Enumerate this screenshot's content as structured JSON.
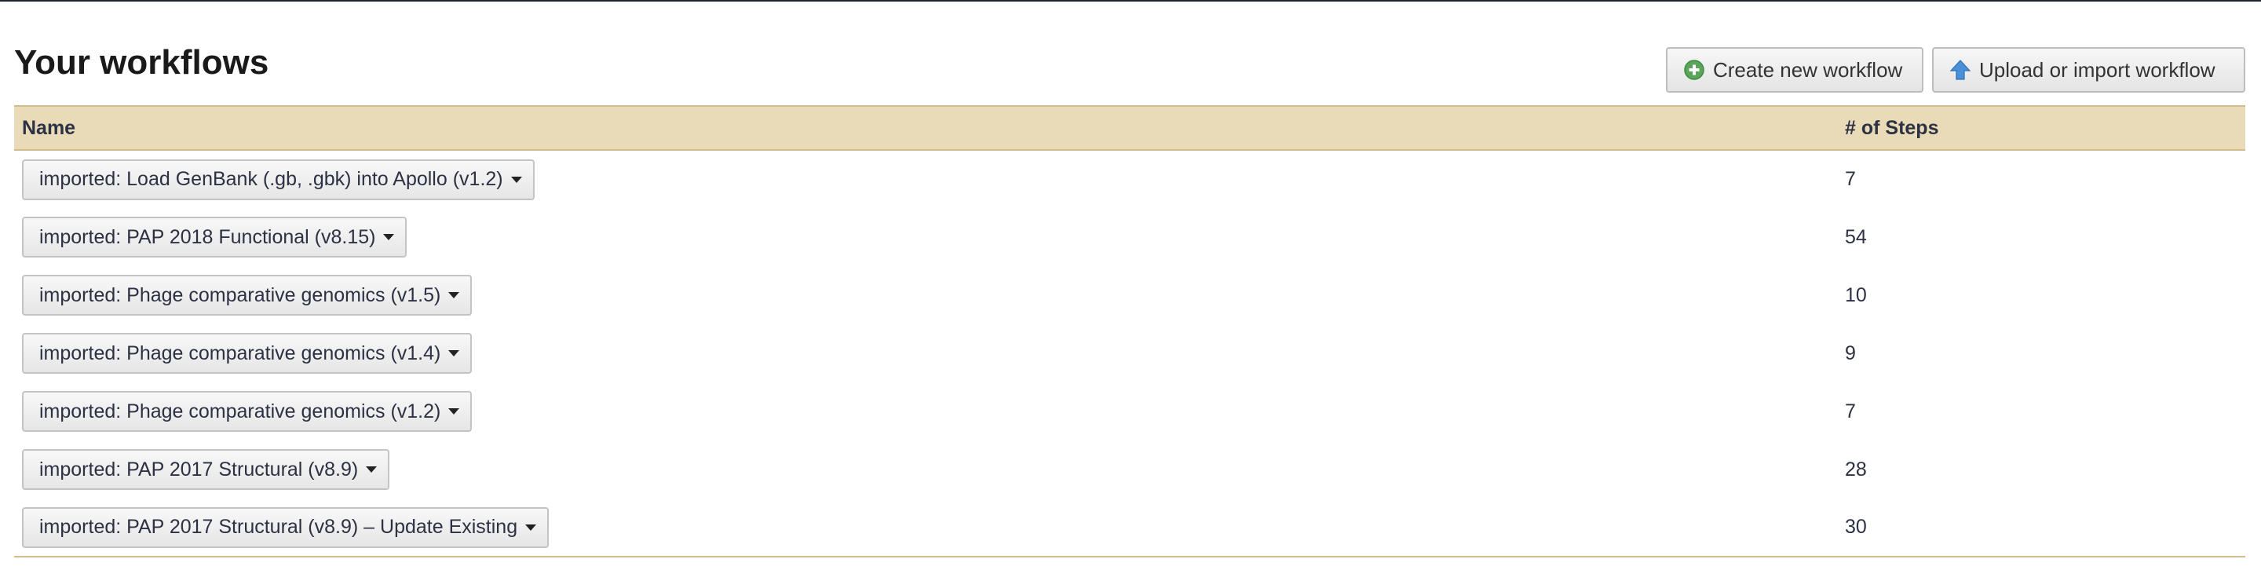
{
  "page_title": "Your workflows",
  "actions": {
    "create_label": "Create new workflow",
    "create_icon": "plus-circle-icon",
    "upload_label": "Upload or import workflow",
    "upload_icon": "upload-arrow-icon"
  },
  "table": {
    "columns": [
      "Name",
      "# of Steps"
    ],
    "rows": [
      {
        "name": "imported: Load GenBank (.gb, .gbk) into Apollo (v1.2)",
        "steps": "7"
      },
      {
        "name": "imported: PAP 2018 Functional (v8.15)",
        "steps": "54"
      },
      {
        "name": "imported: Phage comparative genomics (v1.5)",
        "steps": "10"
      },
      {
        "name": "imported: Phage comparative genomics (v1.4)",
        "steps": "9"
      },
      {
        "name": "imported: Phage comparative genomics (v1.2)",
        "steps": "7"
      },
      {
        "name": "imported: PAP 2017 Structural (v8.9)",
        "steps": "28"
      },
      {
        "name": "imported: PAP 2017 Structural (v8.9) – Update Existing",
        "steps": "30"
      }
    ]
  },
  "colors": {
    "header_bg": "#e9dbb7",
    "header_border": "#d2bd8a",
    "create_icon": "#5aa55a",
    "upload_icon": "#4a90d9"
  }
}
